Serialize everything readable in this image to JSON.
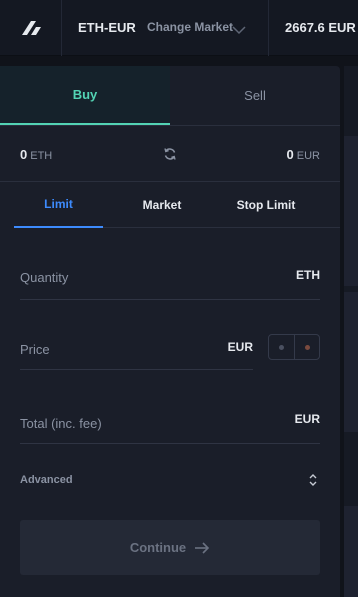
{
  "header": {
    "market": "ETH-EUR",
    "change_market_label": "Change Market",
    "last_price": "2667.6 EUR",
    "logo_icon": "exchange-logo-icon"
  },
  "order_form": {
    "side_tabs": {
      "buy": "Buy",
      "sell": "Sell",
      "active": "Buy"
    },
    "balances": {
      "left_amount": "0",
      "left_currency": "ETH",
      "right_amount": "0",
      "right_currency": "EUR",
      "swap_icon": "refresh-icon"
    },
    "order_type_tabs": [
      {
        "label": "Limit",
        "active": true
      },
      {
        "label": "Market",
        "active": false
      },
      {
        "label": "Stop Limit",
        "active": false
      }
    ],
    "quantity": {
      "label": "Quantity",
      "unit": "ETH"
    },
    "price": {
      "label": "Price",
      "unit": "EUR"
    },
    "total": {
      "label": "Total (inc. fee)",
      "unit": "EUR"
    },
    "advanced": {
      "label": "Advanced",
      "icon": "sort-toggle-icon"
    },
    "submit": {
      "label": "Continue",
      "icon": "arrow-right-icon"
    }
  },
  "colors": {
    "buy_accent": "#53d3b4",
    "tab_accent": "#3d8bfd",
    "panel_bg": "#1a1e29",
    "page_bg": "#10131a"
  }
}
